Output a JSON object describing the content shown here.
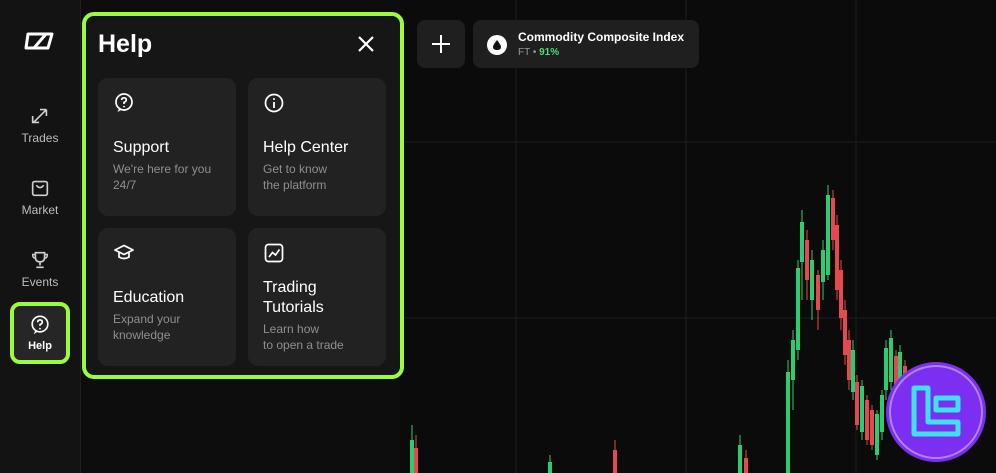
{
  "sidebar": {
    "items": [
      {
        "label": "Trades",
        "icon": "trades-arrows-icon"
      },
      {
        "label": "Market",
        "icon": "market-bag-icon"
      },
      {
        "label": "Events",
        "icon": "trophy-icon"
      },
      {
        "label": "Help",
        "icon": "help-question-icon",
        "active": true
      }
    ]
  },
  "help": {
    "title": "Help",
    "cards": [
      {
        "title": "Support",
        "desc1": "We're here for you",
        "desc2": "24/7",
        "icon": "support-question-icon"
      },
      {
        "title": "Help Center",
        "desc1": "Get to know",
        "desc2": "the platform",
        "icon": "info-icon"
      },
      {
        "title": "Education",
        "desc1": "Expand your",
        "desc2": "knowledge",
        "icon": "graduation-cap-icon"
      },
      {
        "title1": "Trading",
        "title2": "Tutorials",
        "desc1": "Learn how",
        "desc2": "to open a trade",
        "icon": "chart-line-icon"
      }
    ]
  },
  "asset": {
    "name": "Commodity Composite Index",
    "ticker": "FT",
    "separator": "•",
    "percent": "91%",
    "icon": "drop-icon"
  },
  "colors": {
    "accent": "#9afc3c",
    "up": "#2ecc71",
    "down": "#e5484d",
    "watermark": "#7c2ff0"
  }
}
